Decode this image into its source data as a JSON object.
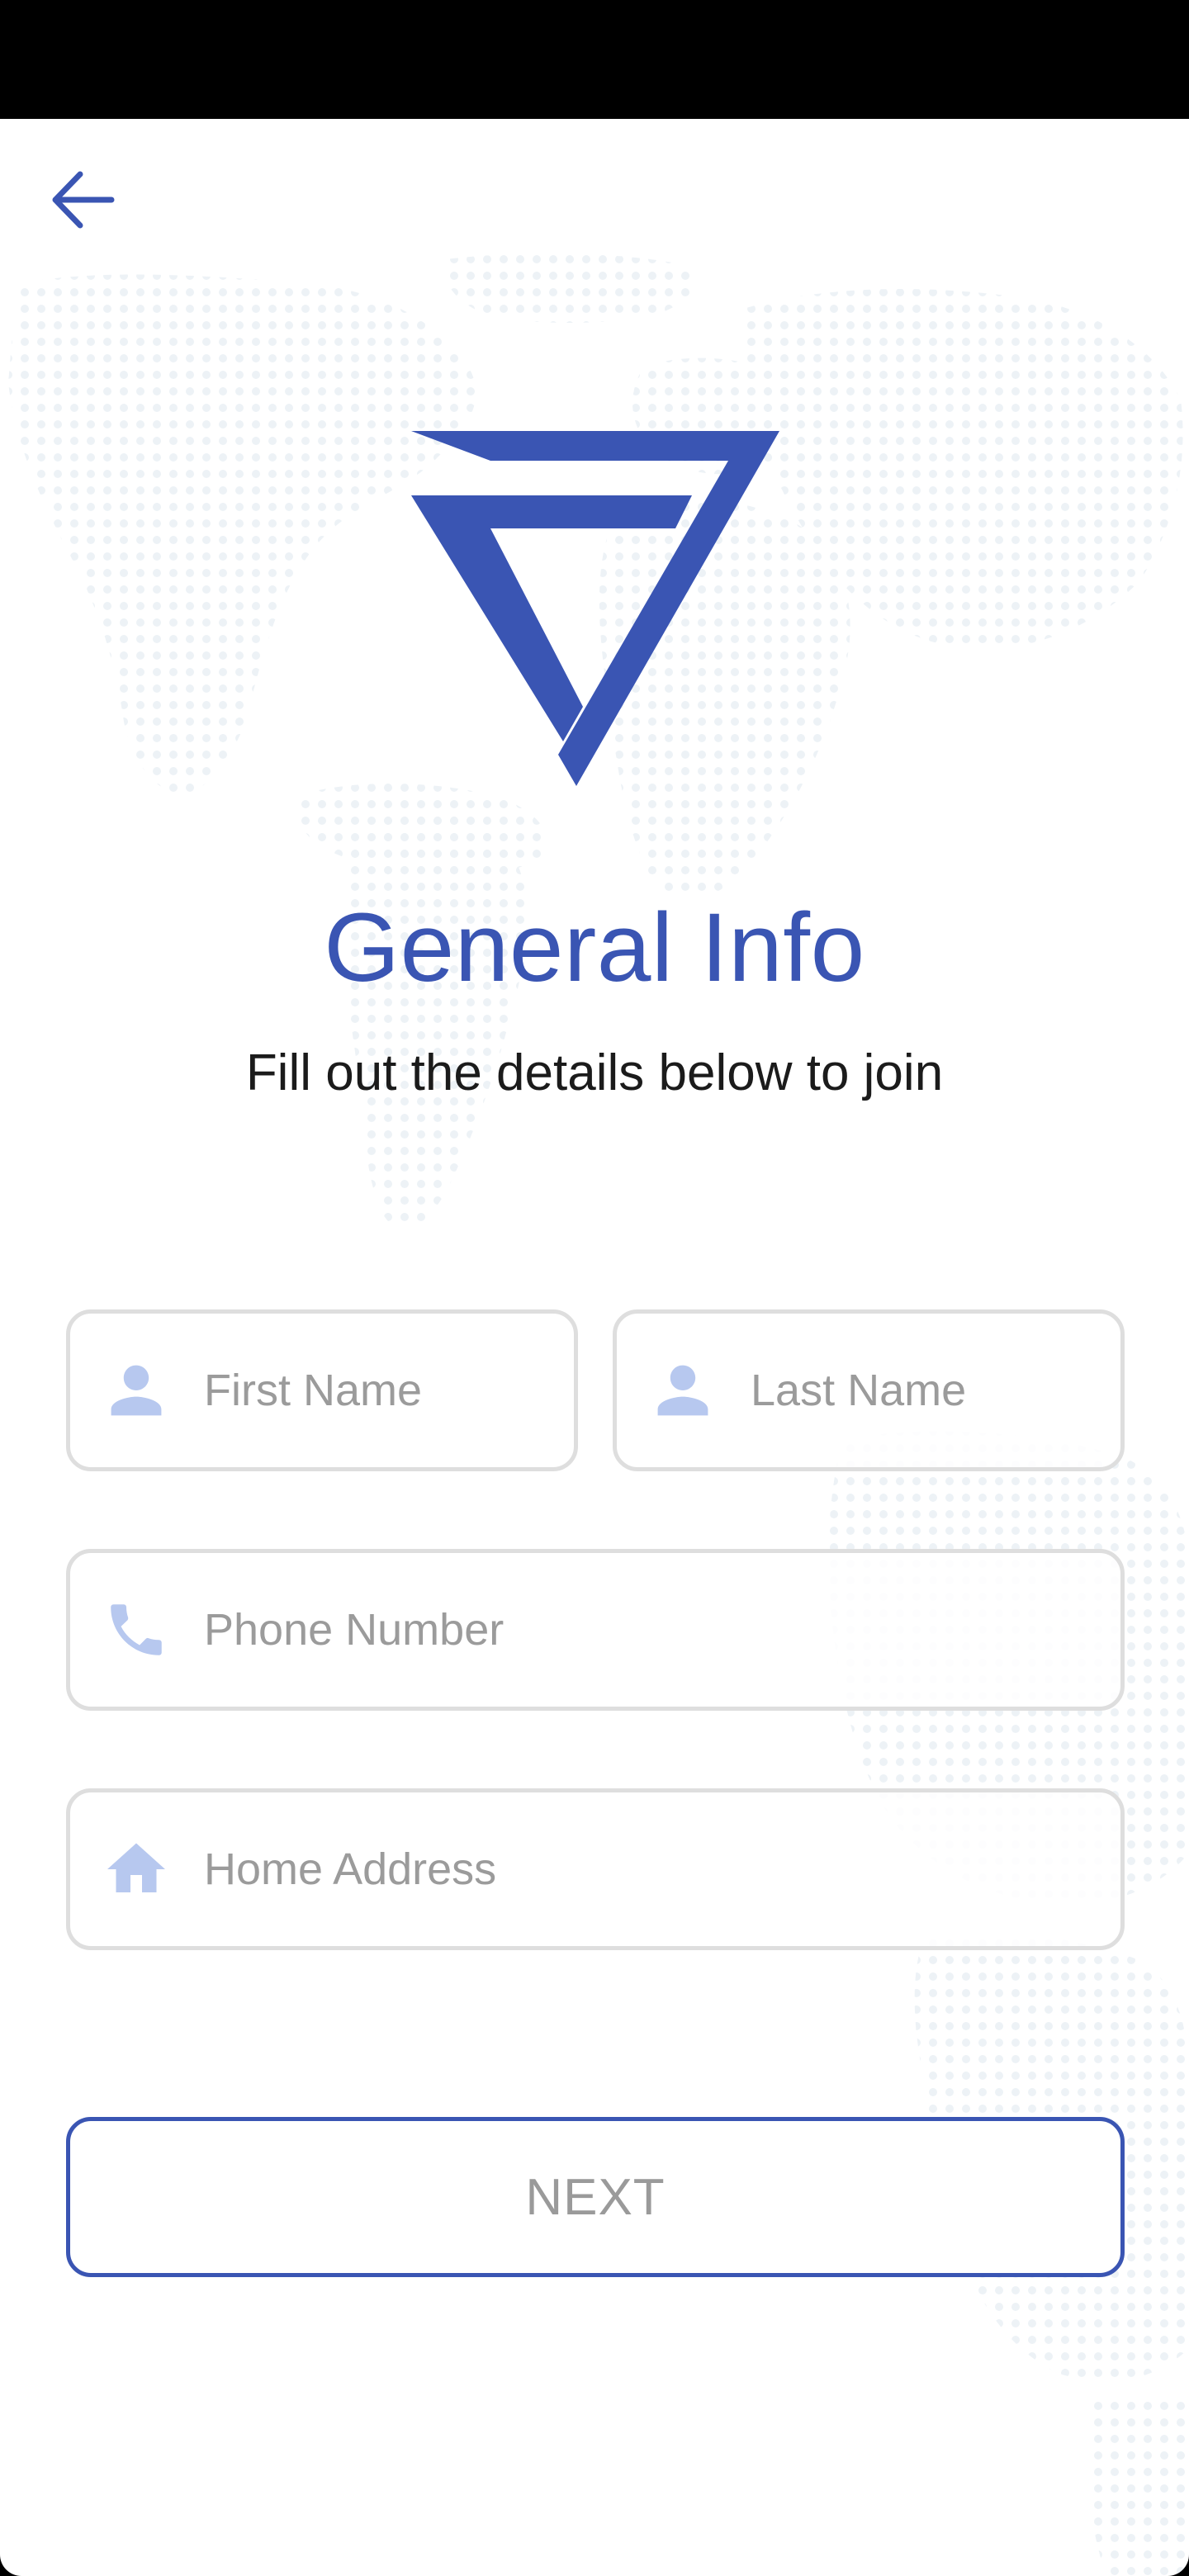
{
  "header": {
    "back_icon": "arrow-left-icon"
  },
  "logo": {
    "icon": "triangle-seven-logo",
    "color": "#3a55b3"
  },
  "main": {
    "title": "General Info",
    "subtitle": "Fill out the details below to join"
  },
  "form": {
    "first_name": {
      "placeholder": "First Name",
      "value": "",
      "icon": "person-icon"
    },
    "last_name": {
      "placeholder": "Last Name",
      "value": "",
      "icon": "person-icon"
    },
    "phone": {
      "placeholder": "Phone Number",
      "value": "",
      "icon": "phone-icon"
    },
    "address": {
      "placeholder": "Home Address",
      "value": "",
      "icon": "home-icon"
    }
  },
  "actions": {
    "next_label": "NEXT"
  },
  "colors": {
    "accent": "#3a55b3",
    "icon_light": "#b7c8ef",
    "field_border": "#dedede",
    "placeholder": "#9b9b9b",
    "status_bar": "#000000"
  }
}
